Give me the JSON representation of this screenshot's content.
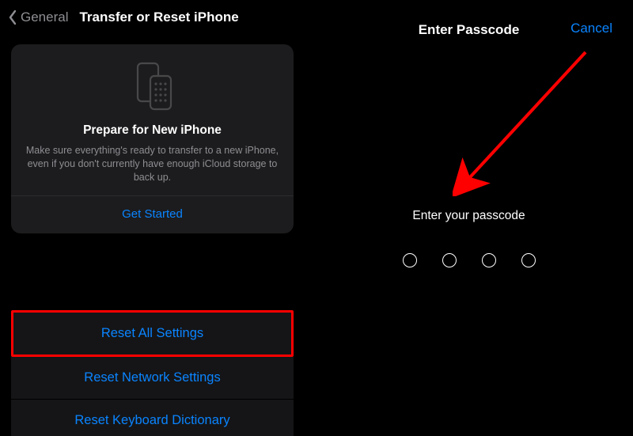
{
  "nav": {
    "back_label": "General",
    "title": "Transfer or Reset iPhone"
  },
  "prepare_card": {
    "title": "Prepare for New iPhone",
    "description": "Make sure everything's ready to transfer to a new iPhone, even if you don't currently have enough iCloud storage to back up.",
    "action": "Get Started"
  },
  "reset_options": [
    {
      "label": "Reset All Settings",
      "highlighted": true
    },
    {
      "label": "Reset Network Settings",
      "highlighted": false
    },
    {
      "label": "Reset Keyboard Dictionary",
      "highlighted": false
    }
  ],
  "passcode": {
    "title": "Enter Passcode",
    "cancel": "Cancel",
    "prompt": "Enter your passcode",
    "digits": 4
  }
}
